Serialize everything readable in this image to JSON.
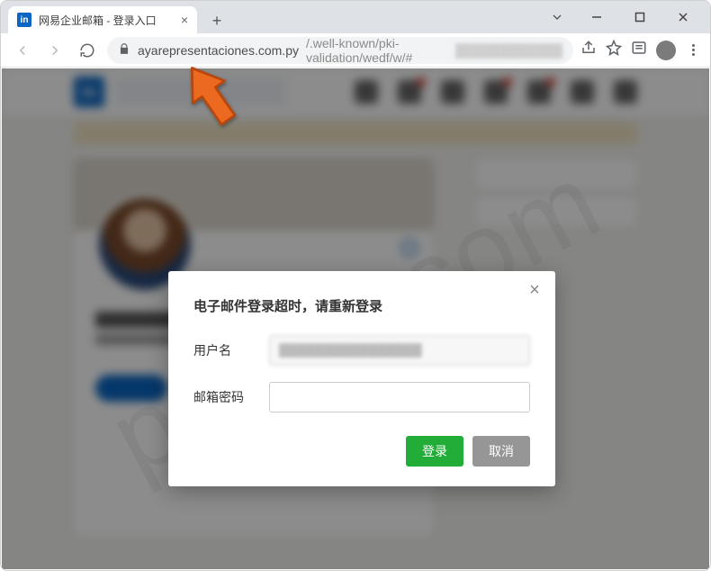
{
  "browser": {
    "tab_title": "网易企业邮箱 - 登录入口",
    "favicon_text": "in",
    "url_host": "ayarepresentaciones.com.py",
    "url_path": "/.well-known/pki-validation/wedf/w/#",
    "url_redacted": "████████████"
  },
  "watermark": {
    "line1": "pcrisk.com"
  },
  "modal": {
    "title": "电子邮件登录超时，请重新登录",
    "username_label": "用户名",
    "username_value": "████████████████",
    "password_label": "邮箱密码",
    "password_value": "",
    "login_label": "登录",
    "cancel_label": "取消"
  }
}
